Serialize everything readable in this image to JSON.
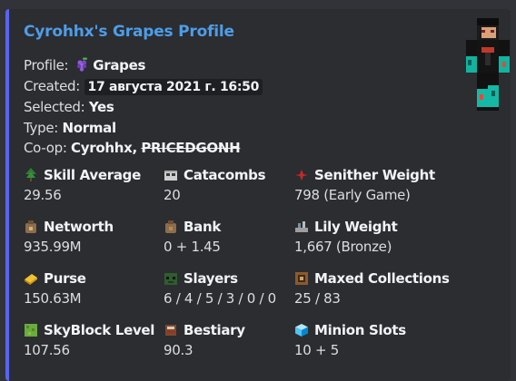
{
  "embed": {
    "title": "Cyrohhx's Grapes Profile",
    "accent": "#5865f2"
  },
  "info": {
    "profile_label": "Profile:",
    "profile_value": "Grapes",
    "created_label": "Created:",
    "created_value": "17 августа 2021 г. 16:50",
    "selected_label": "Selected:",
    "selected_value": "Yes",
    "type_label": "Type:",
    "type_value": "Normal",
    "coop_label": "Co-op:",
    "coop_member_1": "Cyrohhx",
    "coop_sep": ",",
    "coop_member_2": "PRICEDGONH"
  },
  "fields": [
    {
      "name": "Skill Average",
      "value": "29.56",
      "icon": "skill-tree-icon"
    },
    {
      "name": "Catacombs",
      "value": "20",
      "icon": "skull-icon"
    },
    {
      "name": "Senither Weight",
      "value": "798 (Early Game)",
      "icon": "red-star-icon"
    },
    {
      "name": "Networth",
      "value": "935.99M",
      "icon": "money-bag-icon"
    },
    {
      "name": "Bank",
      "value": "0 + 1.45",
      "icon": "bank-bag-icon"
    },
    {
      "name": "Lily Weight",
      "value": "1,667 (Bronze)",
      "icon": "lily-weight-icon"
    },
    {
      "name": "Purse",
      "value": "150.63M",
      "icon": "gold-coin-icon"
    },
    {
      "name": "Slayers",
      "value": "6 / 4 / 5 / 3 / 0 / 0",
      "icon": "slayer-head-icon"
    },
    {
      "name": "Maxed Collections",
      "value": "25 / 83",
      "icon": "item-frame-icon"
    },
    {
      "name": "SkyBlock Level",
      "value": "107.56",
      "icon": "grass-block-icon"
    },
    {
      "name": "Bestiary",
      "value": "90.3",
      "icon": "bestiary-book-icon"
    },
    {
      "name": "Minion Slots",
      "value": "10 + 5",
      "icon": "minion-cube-icon"
    }
  ]
}
